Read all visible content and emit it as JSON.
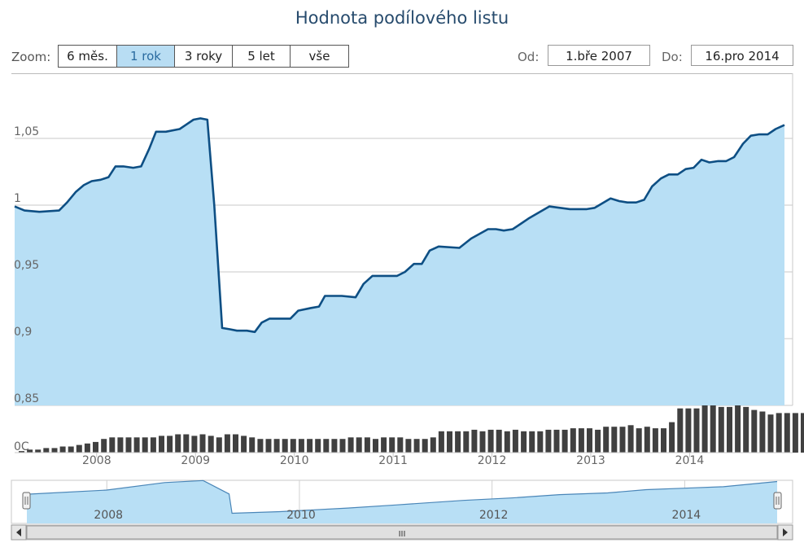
{
  "title": "Hodnota podílového listu",
  "zoom": {
    "label": "Zoom:",
    "buttons": [
      "6 měs.",
      "1 rok",
      "3 roky",
      "5 let",
      "vše"
    ],
    "active": "1 rok"
  },
  "range": {
    "from_label": "Od:",
    "from_value": "1.bře 2007",
    "to_label": "Do:",
    "to_value": "16.pro 2014"
  },
  "navigator": {
    "ticks": [
      "2008",
      "2010",
      "2012",
      "2014"
    ],
    "scroll_grip": "III"
  },
  "chart_data": {
    "type": "area",
    "title": "Hodnota podílového listu",
    "x_ticks": [
      "2008",
      "2009",
      "2010",
      "2011",
      "2012",
      "2013",
      "2014"
    ],
    "y_ticks": [
      "0,85",
      "0,9",
      "0,95",
      "1",
      "1,05"
    ],
    "ylim": [
      0.85,
      1.07
    ],
    "xlim": [
      2007.17,
      2014.96
    ],
    "grid": true,
    "area_color": "#b8dff5",
    "line_color": "#0e4f84",
    "series": [
      {
        "x": [
          2007.17,
          2007.27,
          2007.42,
          2007.62,
          2007.7,
          2007.79,
          2007.87,
          2007.95,
          2008.04,
          2008.12,
          2008.19,
          2008.27,
          2008.37,
          2008.45,
          2008.53,
          2008.6,
          2008.7,
          2008.84,
          2008.9,
          2008.98,
          2009.05,
          2009.12,
          2009.19,
          2009.27,
          2009.35,
          2009.42,
          2009.52,
          2009.6,
          2009.67,
          2009.75,
          2009.83,
          2009.96,
          2010.04,
          2010.17,
          2010.25,
          2010.31,
          2010.48,
          2010.62,
          2010.7,
          2010.79,
          2010.96,
          2011.04,
          2011.12,
          2011.21,
          2011.29,
          2011.37,
          2011.46,
          2011.67,
          2011.79,
          2011.96,
          2012.04,
          2012.12,
          2012.21,
          2012.29,
          2012.37,
          2012.58,
          2012.79,
          2012.87,
          2012.96,
          2013.04,
          2013.2,
          2013.29,
          2013.37,
          2013.46,
          2013.54,
          2013.62,
          2013.71,
          2013.79,
          2013.88,
          2013.96,
          2014.04,
          2014.12,
          2014.2,
          2014.29,
          2014.37,
          2014.45,
          2014.54,
          2014.62,
          2014.7,
          2014.79,
          2014.87,
          2014.96
        ],
        "values": [
          0.999,
          0.996,
          0.995,
          0.996,
          1.002,
          1.01,
          1.015,
          1.018,
          1.019,
          1.021,
          1.029,
          1.029,
          1.028,
          1.029,
          1.042,
          1.055,
          1.055,
          1.057,
          1.06,
          1.064,
          1.065,
          1.064,
          1.0,
          0.908,
          0.907,
          0.906,
          0.906,
          0.905,
          0.912,
          0.915,
          0.915,
          0.915,
          0.921,
          0.923,
          0.924,
          0.932,
          0.932,
          0.931,
          0.941,
          0.947,
          0.947,
          0.947,
          0.95,
          0.956,
          0.956,
          0.966,
          0.969,
          0.968,
          0.975,
          0.982,
          0.982,
          0.981,
          0.982,
          0.986,
          0.99,
          0.999,
          0.997,
          0.997,
          0.997,
          0.998,
          1.005,
          1.003,
          1.002,
          1.002,
          1.004,
          1.014,
          1.02,
          1.023,
          1.023,
          1.027,
          1.028,
          1.034,
          1.032,
          1.033,
          1.033,
          1.036,
          1.046,
          1.052,
          1.053,
          1.053,
          1.057,
          1.06
        ]
      }
    ],
    "volume": {
      "type": "bar",
      "color": "#404040",
      "x_start": 2007.24,
      "x_step": 0.0833,
      "values": [
        1,
        2,
        2,
        3,
        3,
        4,
        4,
        5,
        6,
        7,
        9,
        10,
        10,
        10,
        10,
        10,
        10,
        11,
        11,
        12,
        12,
        11,
        12,
        11,
        10,
        12,
        12,
        11,
        10,
        9,
        9,
        9,
        9,
        9,
        9,
        9,
        9,
        9,
        9,
        9,
        10,
        10,
        10,
        9,
        10,
        10,
        10,
        9,
        9,
        9,
        10,
        14,
        14,
        14,
        14,
        15,
        14,
        15,
        15,
        14,
        15,
        14,
        14,
        14,
        15,
        15,
        15,
        16,
        16,
        16,
        15,
        17,
        17,
        17,
        18,
        16,
        17,
        16,
        16,
        20,
        29,
        29,
        29,
        31,
        31,
        30,
        30,
        31,
        30,
        28,
        27,
        25,
        26,
        26,
        26,
        26,
        27,
        27,
        28,
        30,
        29,
        28,
        24,
        13
      ]
    },
    "navigator_series": [
      {
        "x": [
          2007.17,
          2008.0,
          2008.6,
          2009.0,
          2009.27,
          2009.3,
          2009.8,
          2010.5,
          2011.0,
          2011.7,
          2012.2,
          2012.7,
          2013.2,
          2013.6,
          2014.0,
          2014.4,
          2014.96
        ],
        "values": [
          0.999,
          1.019,
          1.055,
          1.065,
          1.0,
          0.907,
          0.915,
          0.932,
          0.947,
          0.969,
          0.981,
          0.997,
          1.005,
          1.021,
          1.028,
          1.035,
          1.06
        ]
      }
    ]
  }
}
